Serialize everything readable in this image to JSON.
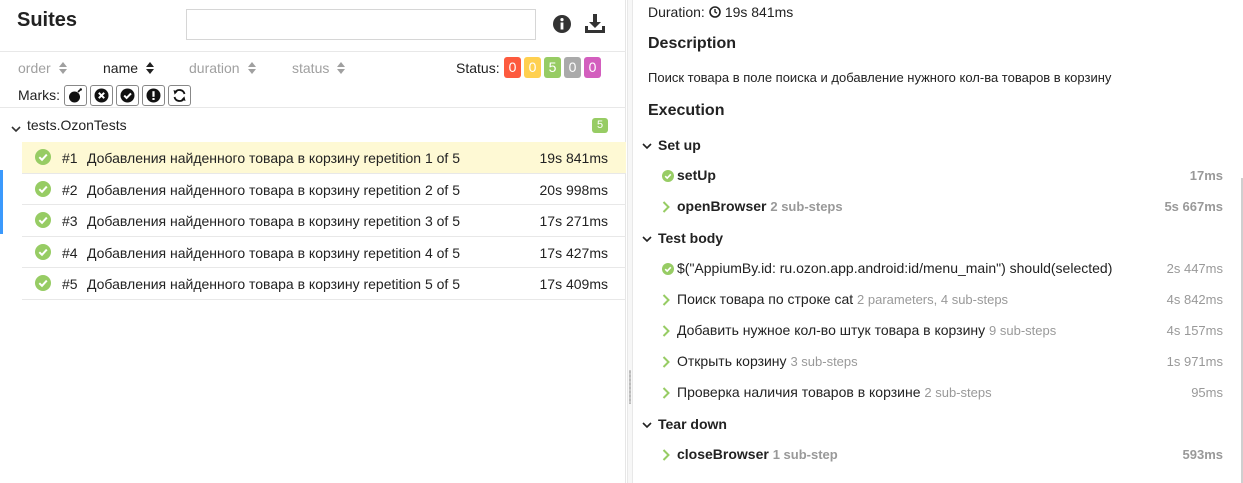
{
  "left_pane": {
    "title": "Suites",
    "search": {
      "value": "",
      "placeholder": ""
    },
    "icons": {
      "info": "info-icon",
      "download": "download-icon"
    },
    "sort": {
      "order": "order",
      "name": "name",
      "duration": "duration",
      "status": "status"
    },
    "status": {
      "label": "Status:",
      "counts": [
        {
          "name": "failed",
          "value": "0",
          "color": "#fd5a3e"
        },
        {
          "name": "broken",
          "value": "0",
          "color": "#ffd050"
        },
        {
          "name": "passed",
          "value": "5",
          "color": "#97cc64"
        },
        {
          "name": "skipped",
          "value": "0",
          "color": "#aaaaaa"
        },
        {
          "name": "unknown",
          "value": "0",
          "color": "#d35ebe"
        }
      ]
    },
    "marks": {
      "label": "Marks:",
      "items": [
        "bomb-icon",
        "close-circle-icon",
        "check-circle-icon",
        "exclamation-circle-icon",
        "refresh-icon"
      ]
    },
    "group": {
      "name": "tests.OzonTests",
      "count": "5"
    },
    "tests": [
      {
        "num": "#1",
        "name": "Добавления найденного товара в корзину repetition 1 of 5",
        "duration": "19s 841ms",
        "selected": true
      },
      {
        "num": "#2",
        "name": "Добавления найденного товара в корзину repetition 2 of 5",
        "duration": "20s 998ms",
        "selected": false
      },
      {
        "num": "#3",
        "name": "Добавления найденного товара в корзину repetition 3 of 5",
        "duration": "17s 271ms",
        "selected": false
      },
      {
        "num": "#4",
        "name": "Добавления найденного товара в корзину repetition 4 of 5",
        "duration": "17s 427ms",
        "selected": false
      },
      {
        "num": "#5",
        "name": "Добавления найденного товара в корзину repetition 5 of 5",
        "duration": "17s 409ms",
        "selected": false
      }
    ]
  },
  "right_pane": {
    "duration_label": "Duration:",
    "duration_value": "19s 841ms",
    "description_title": "Description",
    "description_text": "Поиск товара в поле поиска и добавление нужного кол-ва товаров в корзину",
    "execution_title": "Execution",
    "stages": [
      {
        "name": "Set up",
        "steps": [
          {
            "name": "setUp",
            "sub": "",
            "duration": "17ms",
            "icon": "passed",
            "bold": true
          },
          {
            "name": "openBrowser",
            "sub": "2 sub-steps",
            "duration": "5s 667ms",
            "icon": "expand",
            "bold": true
          }
        ]
      },
      {
        "name": "Test body",
        "steps": [
          {
            "name": "$(\"AppiumBy.id: ru.ozon.app.android:id/menu_main\") should(selected)",
            "sub": "",
            "duration": "2s 447ms",
            "icon": "passed",
            "bold": false
          },
          {
            "name": "Поиск товара по строке cat",
            "sub": "2 parameters, 4 sub-steps",
            "duration": "4s 842ms",
            "icon": "expand",
            "bold": false
          },
          {
            "name": "Добавить нужное кол-во штук товара в корзину",
            "sub": "9 sub-steps",
            "duration": "4s 157ms",
            "icon": "expand",
            "bold": false
          },
          {
            "name": "Открыть корзину",
            "sub": "3 sub-steps",
            "duration": "1s 971ms",
            "icon": "expand",
            "bold": false
          },
          {
            "name": "Проверка наличия товаров в корзине",
            "sub": "2 sub-steps",
            "duration": "95ms",
            "icon": "expand",
            "bold": false
          }
        ]
      },
      {
        "name": "Tear down",
        "steps": [
          {
            "name": "closeBrowser",
            "sub": "1 sub-step",
            "duration": "593ms",
            "icon": "expand",
            "bold": true
          }
        ]
      }
    ]
  }
}
